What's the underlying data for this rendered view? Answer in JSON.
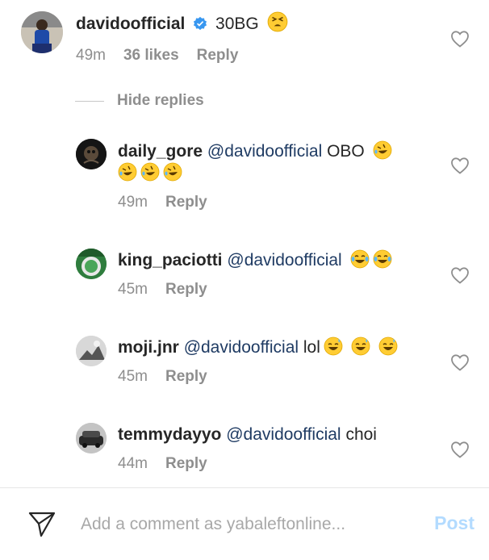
{
  "main_comment": {
    "username": "davidoofficial",
    "verified_icon": "verified-badge-icon",
    "text": "30BG",
    "emojis": [
      "tired-face-emoji"
    ],
    "time": "49m",
    "likes": "36 likes",
    "reply": "Reply"
  },
  "hide_replies": "Hide replies",
  "replies": [
    {
      "username": "daily_gore",
      "mention": "@davidoofficial",
      "text": "OBO",
      "time": "49m",
      "reply": "Reply"
    },
    {
      "username": "king_paciotti",
      "mention": "@davidoofficial",
      "text": "",
      "time": "45m",
      "reply": "Reply"
    },
    {
      "username": "moji.jnr",
      "mention": "@davidoofficial",
      "text": "lol",
      "time": "45m",
      "reply": "Reply"
    },
    {
      "username": "temmydayyo",
      "mention": "@davidoofficial",
      "text": "choi",
      "time": "44m",
      "reply": "Reply"
    }
  ],
  "composer": {
    "placeholder": "Add a comment as yabaleftonline...",
    "post_label": "Post"
  },
  "colors": {
    "post_disabled": "#b3dbff",
    "mention": "#1f3b63",
    "meta": "#8e8e8e",
    "verified": "#3897f0"
  }
}
